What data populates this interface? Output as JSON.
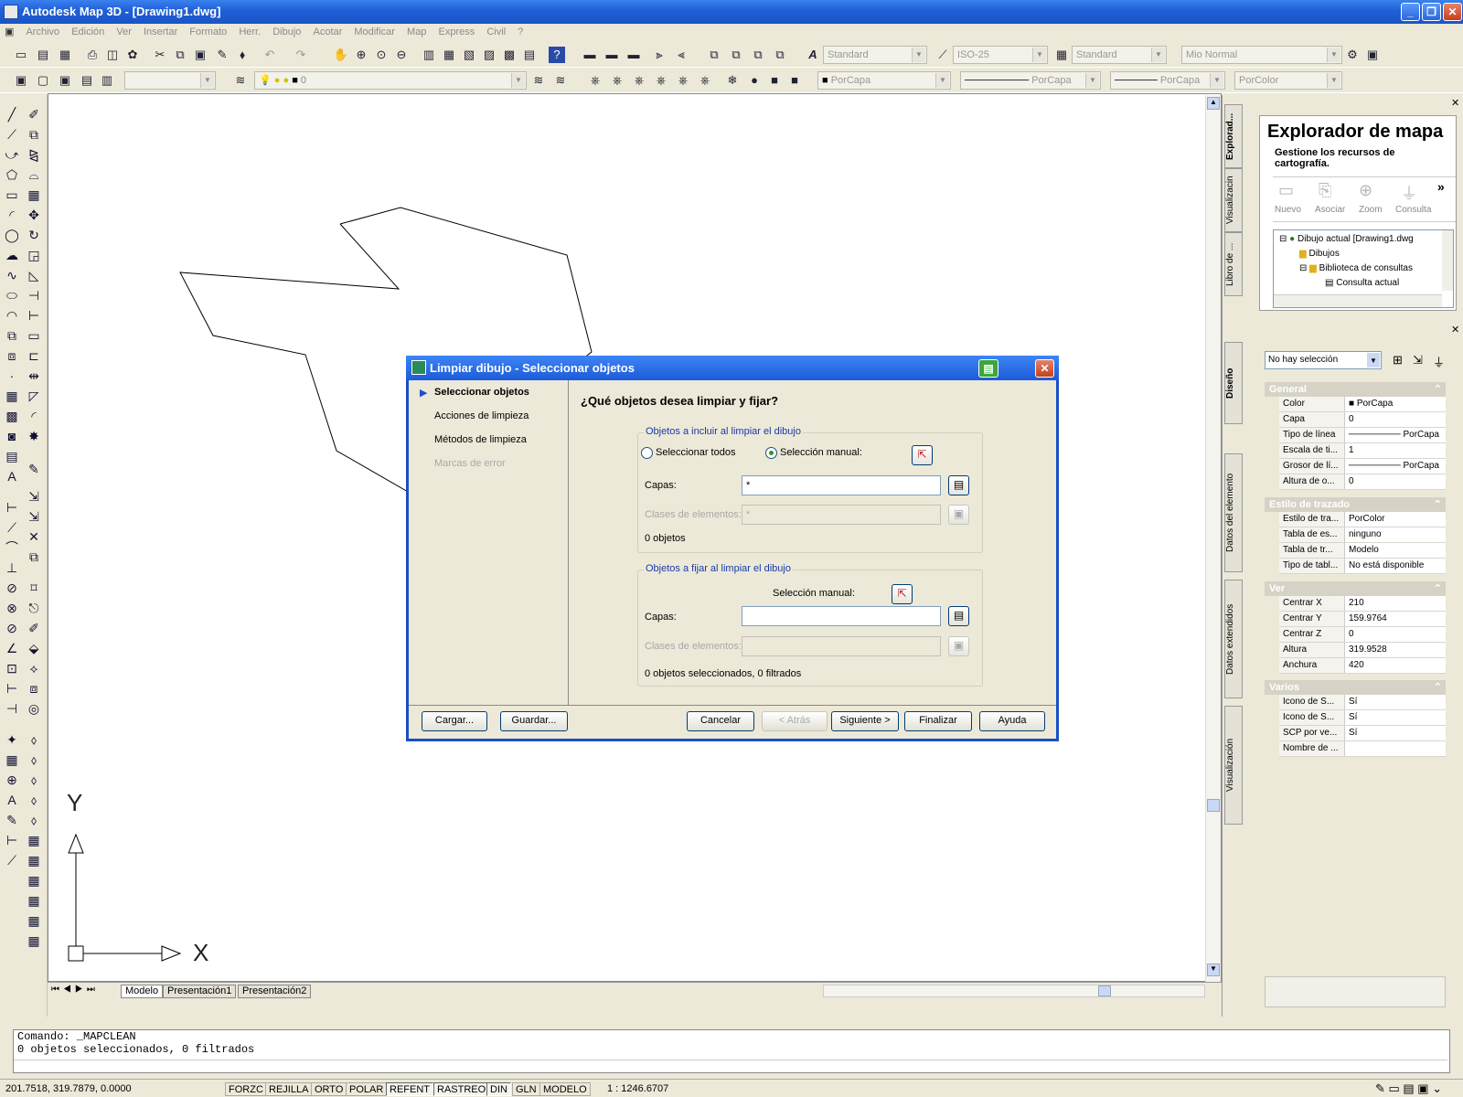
{
  "window": {
    "title": "Autodesk Map 3D - [Drawing1.dwg]"
  },
  "menu": [
    "Archivo",
    "Edición",
    "Ver",
    "Insertar",
    "Formato",
    "Herr.",
    "Dibujo",
    "Acotar",
    "Modificar",
    "Map",
    "Express",
    "Civil",
    "?"
  ],
  "toolbar": {
    "text_style": "Standard",
    "dim_style": "ISO-25",
    "table_style": "Standard",
    "plot_style_name": "Mio Normal",
    "layer": "0",
    "color": "PorCapa",
    "linetype": "PorCapa",
    "lineweight": "PorCapa",
    "plotstyle": "PorColor"
  },
  "layout_tabs": [
    "Modelo",
    "Presentación1",
    "Presentación2"
  ],
  "ucs": {
    "y": "Y",
    "x": "X"
  },
  "map_explorer": {
    "title": "Explorador de mapa",
    "subtitle": "Gestione los recursos de cartografía.",
    "tools": [
      "Nuevo",
      "Asociar",
      "Zoom",
      "Consulta"
    ],
    "more": "»",
    "tree": [
      "Dibujo actual [Drawing1.dwg",
      "Dibujos",
      "Biblioteca de consultas",
      "Consulta actual"
    ]
  },
  "side_tabs_top": [
    "Explorad...",
    "Visualizacin",
    "Libro de ..."
  ],
  "side_tabs_bottom": [
    "Diseño",
    "Datos del elemento",
    "Datos extendidos",
    "Visualización"
  ],
  "properties": {
    "selection": "No hay selección",
    "general_title": "General",
    "general": [
      {
        "k": "Color",
        "v": "PorCapa"
      },
      {
        "k": "Capa",
        "v": "0"
      },
      {
        "k": "Tipo de línea",
        "v": "PorCapa"
      },
      {
        "k": "Escala de ti...",
        "v": "1"
      },
      {
        "k": "Grosor de lí...",
        "v": "PorCapa"
      },
      {
        "k": "Altura de o...",
        "v": "0"
      }
    ],
    "plot_title": "Estilo de trazado",
    "plot": [
      {
        "k": "Estilo de tra...",
        "v": "PorColor"
      },
      {
        "k": "Tabla de es...",
        "v": "ninguno"
      },
      {
        "k": "Tabla de tr...",
        "v": "Modelo"
      },
      {
        "k": "Tipo de tabl...",
        "v": "No está disponible"
      }
    ],
    "view_title": "Ver",
    "view": [
      {
        "k": "Centrar X",
        "v": "210"
      },
      {
        "k": "Centrar Y",
        "v": "159.9764"
      },
      {
        "k": "Centrar Z",
        "v": "0"
      },
      {
        "k": "Altura",
        "v": "319.9528"
      },
      {
        "k": "Anchura",
        "v": "420"
      }
    ],
    "misc_title": "Varios",
    "misc": [
      {
        "k": "Icono de S...",
        "v": "Sí"
      },
      {
        "k": "Icono de S...",
        "v": "Sí"
      },
      {
        "k": "SCP por ve...",
        "v": "Sí"
      },
      {
        "k": "Nombre de ...",
        "v": ""
      }
    ]
  },
  "dialog": {
    "title": "Limpiar dibujo - Seleccionar objetos",
    "nav": [
      "Seleccionar objetos",
      "Acciones de limpieza",
      "Métodos de limpieza",
      "Marcas de error"
    ],
    "question": "¿Qué objetos desea limpiar y fijar?",
    "include_group": "Objetos a incluir al limpiar el dibujo",
    "select_all": "Seleccionar todos",
    "manual_selection": "Selección manual:",
    "layers_label": "Capas:",
    "include_layers_value": "*",
    "feature_classes_label": "Clases de elementos:",
    "include_feature_value": "*",
    "include_count": "0 objetos",
    "fix_group": "Objetos a fijar al limpiar el dibujo",
    "fix_manual": "Selección manual:",
    "fix_layers_value": "",
    "fix_count": "0 objetos seleccionados, 0 filtrados",
    "buttons": {
      "load": "Cargar...",
      "save": "Guardar...",
      "cancel": "Cancelar",
      "back": "< Atrás",
      "next": "Siguiente >",
      "finish": "Finalizar",
      "help": "Ayuda"
    }
  },
  "command": {
    "line1": "Comando: _MAPCLEAN",
    "line2": "0 objetos seleccionados, 0 filtrados"
  },
  "status": {
    "coords": "201.7518, 319.7879, 0.0000",
    "buttons": [
      "FORZC",
      "REJILLA",
      "ORTO",
      "POLAR",
      "REFENT",
      "RASTREO",
      "DIN",
      "GLN",
      "MODELO"
    ],
    "scale": "1 : 1246.6707"
  }
}
